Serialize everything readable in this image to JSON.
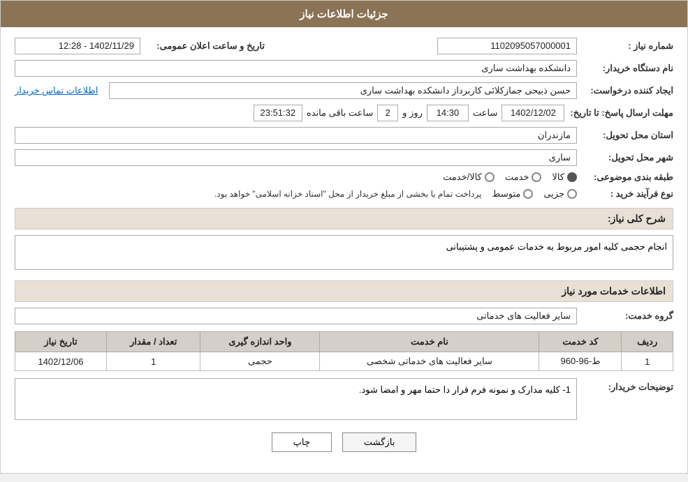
{
  "header": {
    "title": "جزئیات اطلاعات نیاز"
  },
  "fields": {
    "need_number_label": "شماره نیاز :",
    "need_number_value": "1102095057000001",
    "buyer_org_label": "نام دستگاه خریدار:",
    "buyer_org_value": "دانشکده بهداشت ساری",
    "creator_label": "ایجاد کننده درخواست:",
    "creator_value": "حسن ذبیحی جمازکلائی کاربرداز دانشکده بهداشت ساری",
    "creator_link": "اطلاعات تماس خریدار",
    "deadline_label": "مهلت ارسال پاسخ: تا تاریخ:",
    "deadline_date": "1402/12/02",
    "deadline_time_label": "ساعت",
    "deadline_time": "14:30",
    "deadline_days_label": "روز و",
    "deadline_days": "2",
    "deadline_remaining_label": "ساعت باقی مانده",
    "deadline_remaining": "23:51:32",
    "province_label": "استان محل تحویل:",
    "province_value": "مازندران",
    "city_label": "شهر محل تحویل:",
    "city_value": "ساری",
    "category_label": "طبقه بندی موضوعی:",
    "category_options": [
      {
        "label": "کالا",
        "selected": true
      },
      {
        "label": "خدمت",
        "selected": false
      },
      {
        "label": "کالا/خدمت",
        "selected": false
      }
    ],
    "process_label": "نوع فرآیند خرید :",
    "process_options": [
      {
        "label": "جزیی",
        "selected": false
      },
      {
        "label": "متوسط",
        "selected": false
      }
    ],
    "process_note": "پرداخت تمام یا بخشی از مبلغ خریدار از محل \"اسناد خزانه اسلامی\" خواهد بود.",
    "public_announce_label": "تاریخ و ساعت اعلان عمومی:",
    "public_announce_value": "1402/11/29 - 12:28",
    "description_label": "شرح کلی نیاز:",
    "description_value": "انجام حجمی کلیه امور مربوط به خدمات عمومی و پشتیبانی",
    "services_section_label": "اطلاعات خدمات مورد نیاز",
    "service_group_label": "گروه خدمت:",
    "service_group_value": "سایر فعالیت های خدماتی",
    "table": {
      "headers": [
        "ردیف",
        "کد خدمت",
        "نام خدمت",
        "واحد اندازه گیری",
        "تعداد / مقدار",
        "تاریخ نیاز"
      ],
      "rows": [
        {
          "row": "1",
          "code": "ط-96-960",
          "name": "سایر فعالیت های خدماتی شخصی",
          "unit": "حجمی",
          "qty": "1",
          "date": "1402/12/06"
        }
      ]
    },
    "buyer_desc_label": "توضیحات خریدار:",
    "buyer_desc_value": "1- کلیه مدارک و نمونه فرم قرار دا حتما مهر و امضا شود."
  },
  "buttons": {
    "print": "چاپ",
    "back": "بازگشت"
  },
  "colors": {
    "header_bg": "#8B7355",
    "section_bg": "#e8e0d5"
  }
}
